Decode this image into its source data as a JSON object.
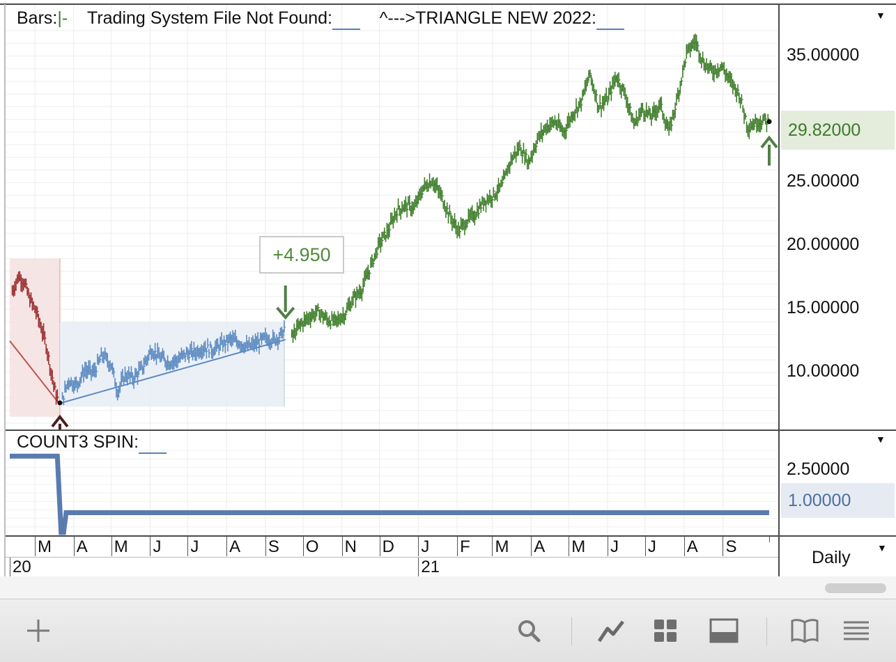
{
  "price_pane": {
    "legend_bars": "Bars:",
    "legend_bars_glyph": "|-",
    "legend_system": "Trading System File Not Found:",
    "legend_triangle": "^--->TRIANGLE NEW 2022:",
    "trade_label": "+4.950",
    "last_price": "29.82000"
  },
  "indicator_pane": {
    "legend": "COUNT3 SPIN:",
    "last_value": "1.00000"
  },
  "period": {
    "label": "Daily"
  },
  "colors": {
    "green": "#3e7d2a",
    "red": "#9a2f2f",
    "blue": "#5b8ac0",
    "indicator": "#5a7bb0",
    "red_zone": "#f4e1e1",
    "blue_zone": "#e8edf6",
    "last_price_bg": "#e4ecdb",
    "last_ind_bg": "#e6ebf3"
  },
  "chart_data": [
    {
      "type": "line",
      "subtype": "ohlc-bars",
      "title": "",
      "x_range": [
        "2020-02-10",
        "2021-10-08"
      ],
      "ylim": [
        5.5,
        38
      ],
      "y_ticks": [
        "35.00000",
        "25.00000",
        "20.00000",
        "15.00000",
        "10.00000"
      ],
      "y_tick_values": [
        35,
        25,
        20,
        15,
        10
      ],
      "log_scale": false,
      "grid": true,
      "series": [
        {
          "segment": "red",
          "x": [
            "2020-02-12",
            "2020-02-17",
            "2020-02-21",
            "2020-02-26",
            "2020-03-02",
            "2020-03-06",
            "2020-03-10",
            "2020-03-13",
            "2020-03-17",
            "2020-03-20"
          ],
          "y": [
            16.4,
            17.6,
            17.2,
            15.8,
            14.8,
            13.6,
            12.2,
            10.6,
            8.6,
            7.6
          ]
        },
        {
          "segment": "blue",
          "x": [
            "2020-03-23",
            "2020-03-28",
            "2020-04-03",
            "2020-04-10",
            "2020-04-17",
            "2020-04-24",
            "2020-05-01",
            "2020-05-06",
            "2020-05-12",
            "2020-05-19",
            "2020-05-26",
            "2020-06-02",
            "2020-06-09",
            "2020-06-16",
            "2020-06-23",
            "2020-06-30",
            "2020-07-07",
            "2020-07-14",
            "2020-07-21",
            "2020-07-28",
            "2020-08-04",
            "2020-08-11",
            "2020-08-18",
            "2020-08-25",
            "2020-09-01",
            "2020-09-08",
            "2020-09-14",
            "2020-09-17"
          ],
          "y": [
            7.9,
            9.4,
            9.0,
            10.2,
            10.0,
            11.4,
            10.6,
            8.5,
            9.8,
            9.6,
            10.4,
            11.8,
            11.2,
            10.8,
            11.0,
            11.5,
            11.6,
            12.0,
            11.8,
            12.2,
            12.6,
            12.4,
            12.0,
            12.3,
            12.7,
            12.6,
            13.0,
            13.8
          ]
        },
        {
          "segment": "green",
          "x": [
            "2020-09-22",
            "2020-09-29",
            "2020-10-06",
            "2020-10-13",
            "2020-10-20",
            "2020-10-27",
            "2020-11-03",
            "2020-11-10",
            "2020-11-17",
            "2020-11-24",
            "2020-12-01",
            "2020-12-08",
            "2020-12-15",
            "2020-12-22",
            "2020-12-29",
            "2021-01-05",
            "2021-01-12",
            "2021-01-19",
            "2021-01-26",
            "2021-02-02",
            "2021-02-09",
            "2021-02-16",
            "2021-02-23",
            "2021-03-02",
            "2021-03-09",
            "2021-03-16",
            "2021-03-23",
            "2021-03-30",
            "2021-04-06",
            "2021-04-13",
            "2021-04-20",
            "2021-04-27",
            "2021-05-04",
            "2021-05-11",
            "2021-05-18",
            "2021-05-25",
            "2021-06-01",
            "2021-06-08",
            "2021-06-15",
            "2021-06-22",
            "2021-06-29",
            "2021-07-06",
            "2021-07-13",
            "2021-07-20",
            "2021-07-27",
            "2021-08-03",
            "2021-08-10",
            "2021-08-17",
            "2021-08-24",
            "2021-08-31",
            "2021-09-07",
            "2021-09-14",
            "2021-09-21",
            "2021-09-28",
            "2021-10-04",
            "2021-10-08"
          ],
          "y": [
            12.8,
            13.8,
            14.4,
            14.8,
            14.2,
            14.0,
            14.6,
            15.8,
            16.6,
            18.4,
            20.2,
            21.2,
            22.8,
            23.2,
            23.0,
            24.6,
            25.2,
            24.0,
            22.4,
            21.2,
            22.0,
            22.6,
            23.6,
            24.0,
            24.8,
            26.8,
            27.8,
            26.6,
            28.4,
            29.4,
            29.8,
            29.0,
            30.4,
            31.4,
            33.6,
            31.0,
            31.6,
            33.4,
            32.0,
            29.6,
            30.8,
            30.2,
            31.2,
            29.0,
            31.8,
            35.2,
            36.2,
            34.4,
            33.8,
            34.2,
            33.0,
            32.0,
            29.4,
            29.8,
            29.9,
            29.82
          ]
        }
      ],
      "trend_lines": [
        {
          "segment": "red",
          "x": [
            "2020-02-10",
            "2020-03-20"
          ],
          "y": [
            12.5,
            7.6
          ]
        },
        {
          "segment": "blue",
          "x": [
            "2020-03-22",
            "2020-09-17"
          ],
          "y": [
            7.6,
            12.6
          ]
        }
      ],
      "zones": [
        {
          "segment": "red",
          "x": [
            "2020-02-10",
            "2020-03-21"
          ],
          "y": [
            6.5,
            19.0
          ]
        },
        {
          "segment": "blue",
          "x": [
            "2020-03-21",
            "2020-09-16"
          ],
          "y": [
            7.3,
            14.0
          ]
        }
      ],
      "annotations": [
        {
          "kind": "entry-arrow-up",
          "segment": "red",
          "x": "2020-03-21",
          "y": 7.6
        },
        {
          "kind": "exit-arrow-down",
          "segment": "green",
          "x": "2020-09-17",
          "y": 13.8,
          "label": "+4.950"
        },
        {
          "kind": "entry-arrow-up",
          "segment": "green",
          "x": "2021-10-08",
          "y": 28.0
        }
      ]
    },
    {
      "type": "line",
      "title": "COUNT3 SPIN",
      "x_range": [
        "2020-02-10",
        "2021-10-08"
      ],
      "ylim": [
        0.2,
        3.5
      ],
      "y_ticks": [
        "2.50000"
      ],
      "y_tick_values": [
        2.5
      ],
      "series": [
        {
          "x": [
            "2020-02-10",
            "2020-03-19",
            "2020-03-22",
            "2020-03-24",
            "2020-03-26",
            "2021-10-08"
          ],
          "y": [
            3.0,
            3.0,
            0.3,
            0.3,
            1.0,
            1.0
          ]
        }
      ]
    }
  ],
  "date_axis": {
    "months": [
      {
        "label": "M",
        "date": "2020-03-01"
      },
      {
        "label": "A",
        "date": "2020-04-01"
      },
      {
        "label": "M",
        "date": "2020-05-01"
      },
      {
        "label": "J",
        "date": "2020-06-01"
      },
      {
        "label": "J",
        "date": "2020-07-01"
      },
      {
        "label": "A",
        "date": "2020-08-01"
      },
      {
        "label": "S",
        "date": "2020-09-01"
      },
      {
        "label": "O",
        "date": "2020-10-01"
      },
      {
        "label": "N",
        "date": "2020-11-01"
      },
      {
        "label": "D",
        "date": "2020-12-01"
      },
      {
        "label": "J",
        "date": "2021-01-01"
      },
      {
        "label": "F",
        "date": "2021-02-01"
      },
      {
        "label": "M",
        "date": "2021-03-01"
      },
      {
        "label": "A",
        "date": "2021-04-01"
      },
      {
        "label": "M",
        "date": "2021-05-01"
      },
      {
        "label": "J",
        "date": "2021-06-01"
      },
      {
        "label": "J",
        "date": "2021-07-01"
      },
      {
        "label": "A",
        "date": "2021-08-01"
      },
      {
        "label": "S",
        "date": "2021-09-01"
      }
    ],
    "years": [
      {
        "label": "20",
        "date": "2020-02-10"
      },
      {
        "label": "21",
        "date": "2021-01-01"
      }
    ]
  },
  "toolbar": {
    "icons": [
      "plus-icon",
      "search-icon",
      "line-chart-icon",
      "grid-icon",
      "panel-icon",
      "book-icon",
      "list-icon"
    ]
  }
}
